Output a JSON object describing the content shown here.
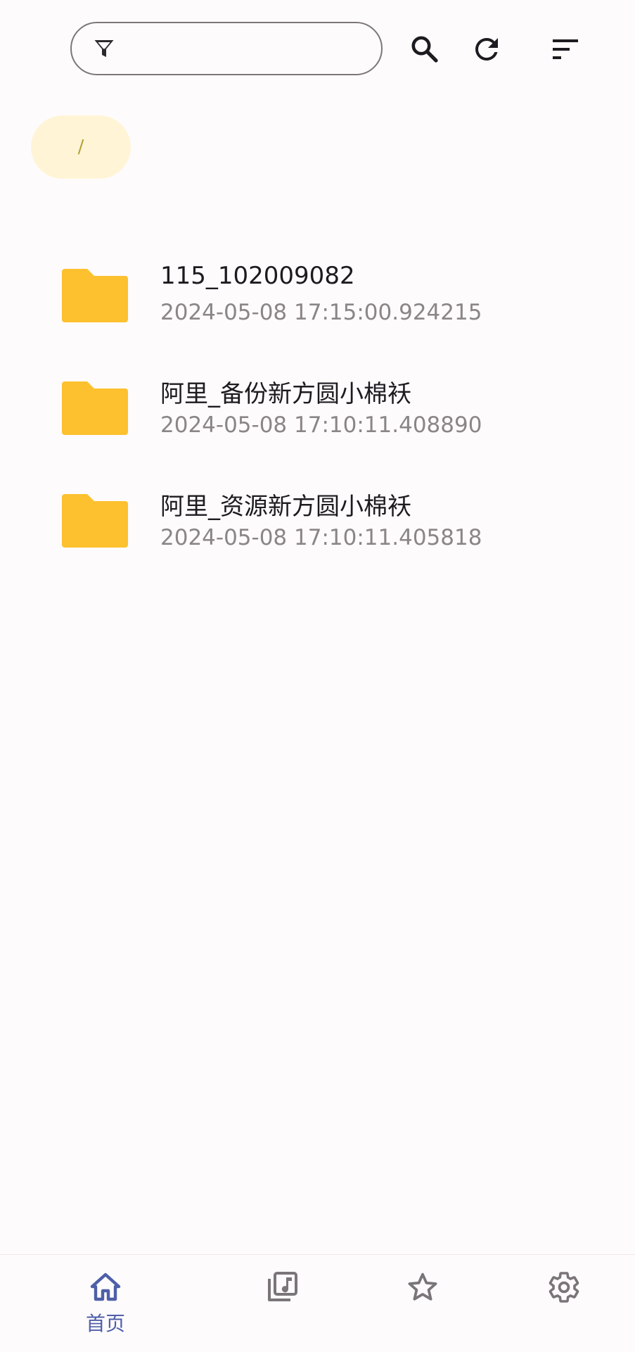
{
  "toolbar": {
    "filter_placeholder": "",
    "filter_value": "",
    "icons": [
      "filter-icon",
      "search-icon",
      "refresh-icon",
      "sort-icon"
    ]
  },
  "breadcrumb": {
    "path": "/"
  },
  "files": [
    {
      "name": "115_102009082",
      "date": "2024-05-08 17:15:00.924215",
      "icon": "folder-icon"
    },
    {
      "name": "阿里_备份新方圆小棉袄",
      "date": "2024-05-08 17:10:11.408890",
      "icon": "folder-icon"
    },
    {
      "name": "阿里_资源新方圆小棉袄",
      "date": "2024-05-08 17:10:11.405818",
      "icon": "folder-icon"
    }
  ],
  "bottom_nav": {
    "items": [
      {
        "label": "首页",
        "icon": "home-icon",
        "active": true
      },
      {
        "label": "",
        "icon": "music-library-icon",
        "active": false
      },
      {
        "label": "",
        "icon": "star-icon",
        "active": false
      },
      {
        "label": "",
        "icon": "gear-icon",
        "active": false
      }
    ]
  },
  "colors": {
    "background": "#fefbfd",
    "folder": "#fdc12f",
    "chip": "#fff5d6",
    "active_nav": "#4e5fa8",
    "inactive_nav": "#7a7578",
    "text_primary": "#1c1b1f",
    "text_secondary": "#8a8587"
  }
}
